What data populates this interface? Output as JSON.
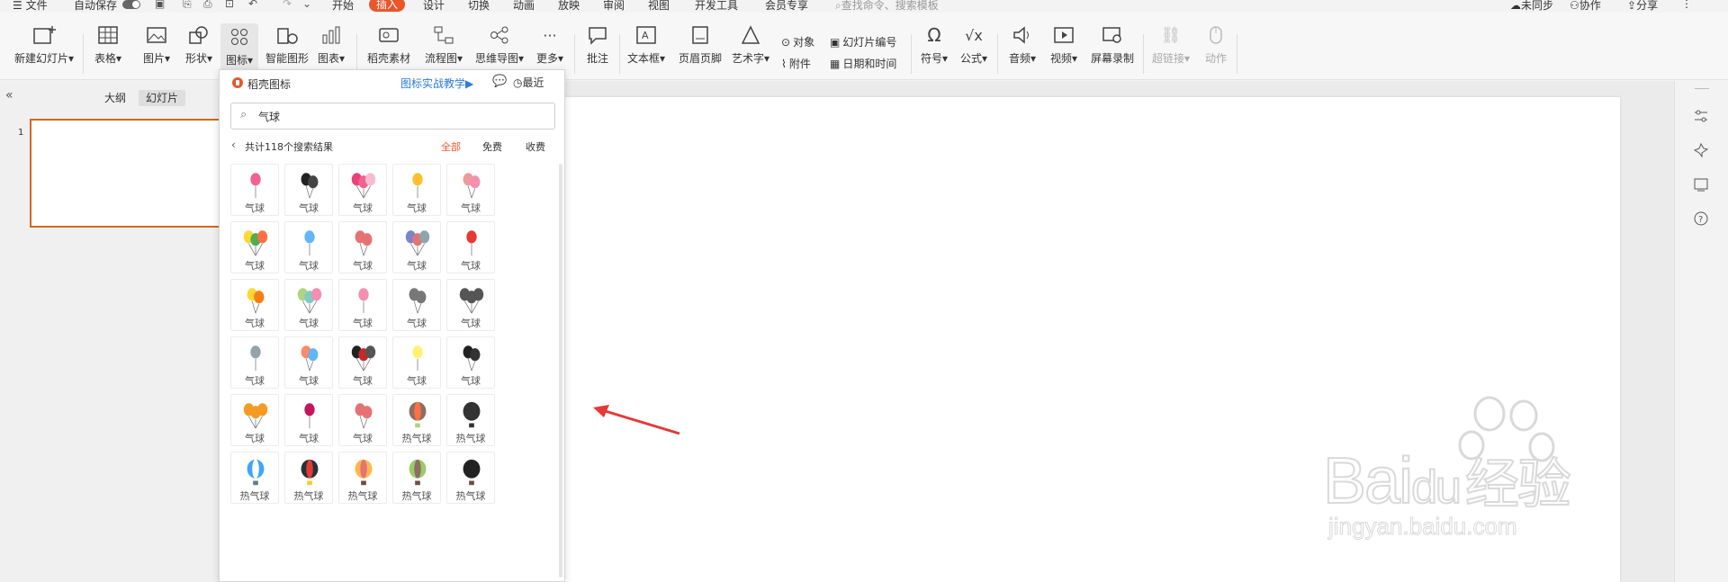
{
  "topbar": {
    "menu_label": "文件",
    "autosave_label": "自动保存",
    "tabs": [
      "开始",
      "插入",
      "设计",
      "切换",
      "动画",
      "放映",
      "审阅",
      "视图",
      "开发工具",
      "会员专享"
    ],
    "active_tab": "插入",
    "search_placeholder": "查找命令、搜索模板",
    "sync_label": "未同步",
    "collab_label": "协作",
    "share_label": "分享"
  },
  "ribbon": {
    "new_slide": "新建幻灯片",
    "table": "表格",
    "picture": "图片",
    "shape": "形状",
    "icon": "图标",
    "smart_art": "智能图形",
    "chart": "图表",
    "docer_material": "稻壳素材",
    "flowchart": "流程图",
    "mindmap": "思维导图",
    "more": "更多",
    "comment": "批注",
    "textbox": "文本框",
    "header_footer": "页眉页脚",
    "wordart": "艺术字",
    "object": "对象",
    "attachment": "附件",
    "slide_number": "幻灯片编号",
    "date_time": "日期和时间",
    "symbol": "符号",
    "formula": "公式",
    "audio": "音频",
    "video": "视频",
    "screen_record": "屏幕录制",
    "hyperlink": "超链接",
    "action": "动作"
  },
  "leftpanel": {
    "outline_tab": "大纲",
    "slides_tab": "幻灯片",
    "slide_number": "1"
  },
  "popup": {
    "brand": "稻壳图标",
    "tutorial_link": "图标实战教学",
    "recent_label": "最近",
    "search_value": "气球",
    "result_count": "共计118个搜索结果",
    "filters": [
      "全部",
      "免费",
      "收费"
    ],
    "active_filter": "全部",
    "icons": [
      [
        "气球",
        "气球",
        "气球",
        "气球",
        "气球"
      ],
      [
        "气球",
        "气球",
        "气球",
        "气球",
        "气球"
      ],
      [
        "气球",
        "气球",
        "气球",
        "气球",
        "气球"
      ],
      [
        "气球",
        "气球",
        "气球",
        "气球",
        "气球"
      ],
      [
        "气球",
        "气球",
        "气球",
        "热气球",
        "热气球"
      ],
      [
        "热气球",
        "热气球",
        "热气球",
        "热气球",
        "热气球"
      ]
    ]
  },
  "watermark": {
    "brand": "Bai",
    "brand2": "du",
    "product": "经验",
    "url": "jingyan.baidu.com"
  },
  "colors": {
    "accent": "#e8562a",
    "link": "#2e7bd6",
    "selection_border": "#d2691e",
    "arrow": "#e53935"
  }
}
